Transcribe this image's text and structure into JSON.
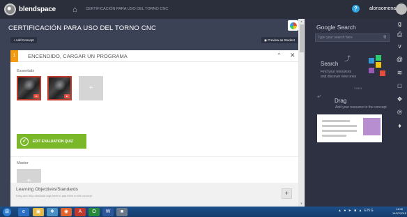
{
  "topbar": {
    "brand": "blendspace",
    "breadcrumb_small": "",
    "breadcrumb": "CERTIFICACIÓN PARA USO DEL TORNO CNC",
    "username": "alonsomena",
    "help": "?"
  },
  "main": {
    "title": "CERTIFICACIÓN PARA USO DEL TORNO CNC",
    "add_concept": "+ Add Concept",
    "preview_label": "Preview as Student",
    "card": {
      "number": "1",
      "title": "ENCENDIDO, CARGAR UN PROGRAMA",
      "essentials_label": "Essentials",
      "master_label": "Master",
      "quiz_label": "EDIT EVALUATION QUIZ",
      "add_symbol": "+",
      "lo_title": "Learning Objectives/Standards",
      "lo_sub": "Drag and drop standard tags here to add them to this concept"
    }
  },
  "side": {
    "title": "Google Search",
    "search_placeholder": "Type your search here",
    "hint_search": "Search",
    "hint_search_sub_1": "Find your resources",
    "hint_search_sub_2": "and discover new ones",
    "hint_then": "THEN",
    "hint_drag": "Drag",
    "hint_drag_sub": "Add your resource to the concept"
  },
  "colors": {
    "accent_green": "#7ab829",
    "badge_orange": "#f39c12",
    "thumb_border": "#c0392b",
    "panel_dark": "#2d3142"
  },
  "taskbar": {
    "clock_time": "14:06",
    "clock_date": "14/07/2015",
    "lang": "ENG"
  }
}
